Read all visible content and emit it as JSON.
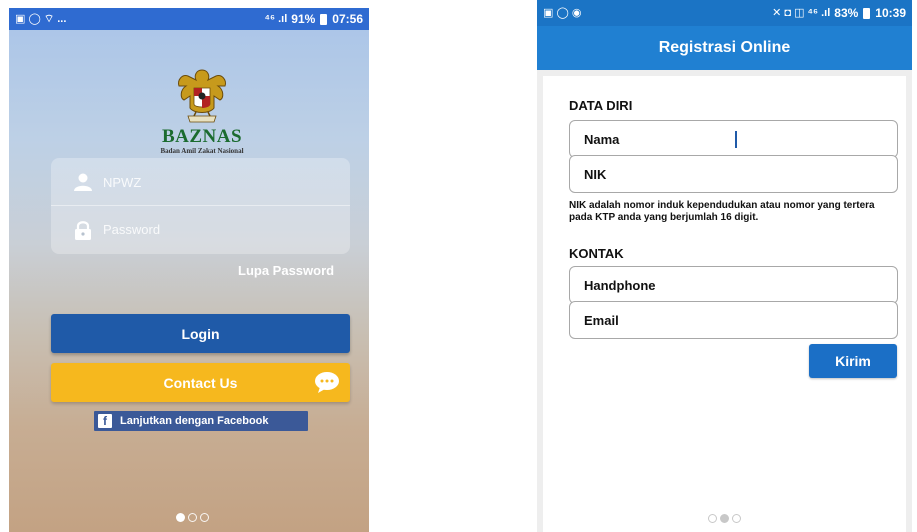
{
  "left_screen": {
    "status_bar": {
      "left_icons": "▣ ◯ ⌔ ...",
      "network": "⁴⁶ .ıl",
      "battery_percent": "91%",
      "time": "07:56"
    },
    "logo": {
      "title": "BAZNAS",
      "subtitle": "Badan Amil Zakat Nasional",
      "icon": "garuda-emblem"
    },
    "login": {
      "username_placeholder": "NPWZ",
      "password_placeholder": "Password",
      "username_icon": "user-icon",
      "password_icon": "lock-icon"
    },
    "forgot_password": "Lupa Password",
    "login_button": "Login",
    "contact_button": "Contact Us",
    "facebook_button": "Lanjutkan dengan Facebook",
    "page_indicator": {
      "count": 3,
      "active": 1
    },
    "colors": {
      "login": "#1f5aa8",
      "contact": "#f6b81e",
      "facebook": "#3b5998",
      "status_bar": "#2f6bd1"
    }
  },
  "right_screen": {
    "status_bar": {
      "left_icons": "▣ ◯ ◉",
      "right_icons": "✕ ◘ ◫ ⁴⁶ .ıl",
      "battery_percent": "83%",
      "time": "10:39"
    },
    "app_bar_title": "Registrasi Online",
    "section_personal": "DATA DIRI",
    "fields_personal": [
      "Nama",
      "NIK"
    ],
    "nik_note": "NIK adalah nomor induk kependudukan atau nomor yang tertera pada KTP anda yang berjumlah 16 digit.",
    "section_contact": "KONTAK",
    "fields_contact": [
      "Handphone",
      "Email"
    ],
    "submit_button": "Kirim",
    "page_indicator": {
      "count": 3,
      "active": 2
    },
    "colors": {
      "app_bar": "#2080d2",
      "status_bar": "#1b74c5",
      "button": "#1b6fc6"
    }
  }
}
